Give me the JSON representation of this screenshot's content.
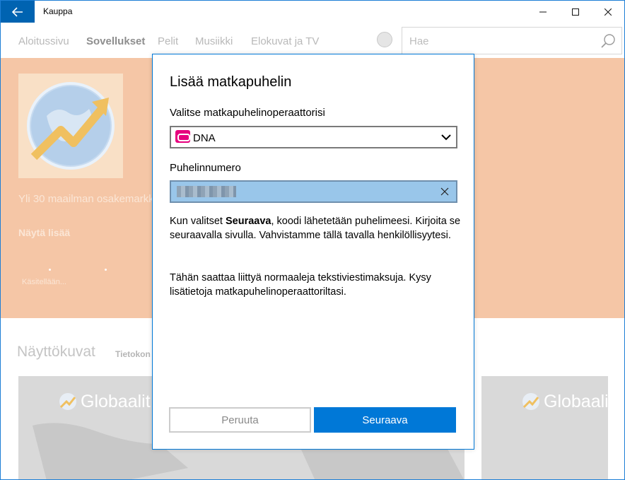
{
  "window": {
    "title": "Kauppa"
  },
  "nav": {
    "items": [
      {
        "label": "Aloitussivu",
        "active": false
      },
      {
        "label": "Sovellukset",
        "active": true
      },
      {
        "label": "Pelit",
        "active": false
      },
      {
        "label": "Musiikki",
        "active": false
      },
      {
        "label": "Elokuvat ja TV",
        "active": false
      }
    ],
    "search_placeholder": "Hae"
  },
  "hero": {
    "description": "Yli 30 maailman osakemarkk",
    "show_more": "Näytä lisää",
    "loading": "Käsitellään..."
  },
  "screenshots": {
    "title": "Näyttökuvat",
    "subtitle": "Tietokon",
    "label": "Globaalit"
  },
  "dialog": {
    "title": "Lisää matkapuhelin",
    "operator_label": "Valitse matkapuhelinoperaattorisi",
    "operator_value": "DNA",
    "phone_label": "Puhelinnumero",
    "phone_value": "",
    "paragraph1_pre": "Kun valitset ",
    "paragraph1_bold": "Seuraava",
    "paragraph1_post": ", koodi lähetetään puhelimeesi. Kirjoita se seuraavalla sivulla. Vahvistamme tällä tavalla henkilöllisyytesi.",
    "paragraph2": "Tähän saattaa liittyä normaaleja tekstiviestimaksuja. Kysy lisätietoja matkapuhelinoperaattoriltasi.",
    "cancel_label": "Peruuta",
    "next_label": "Seuraava"
  },
  "colors": {
    "accent": "#0078d7",
    "titlebar_back": "#0063b1",
    "hero_background": "#f5c6a6",
    "operator_brand": "#e6007e"
  },
  "icons": {
    "back": "arrow-left-icon",
    "search": "magnifier-icon",
    "user": "user-icon",
    "chevron": "chevron-down-icon",
    "clear": "close-icon"
  }
}
